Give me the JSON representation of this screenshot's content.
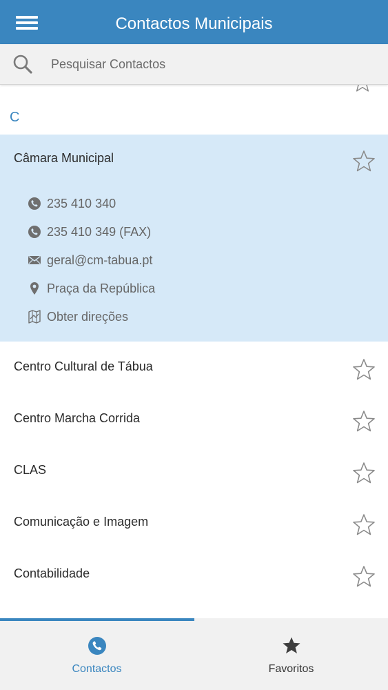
{
  "colors": {
    "primary": "#3a86bf",
    "expanded_bg": "#d6e9f8",
    "text_dark": "#2b2b2b",
    "text_muted": "#666666",
    "nav_bg": "#f1f1f1"
  },
  "header": {
    "title": "Contactos Municipais",
    "menu_icon": "hamburger-menu-icon"
  },
  "search": {
    "placeholder": "Pesquisar Contactos",
    "value": "",
    "icon": "search-icon"
  },
  "list": {
    "section_letter": "C",
    "expanded_item": {
      "title": "Câmara Municipal",
      "favorite": false,
      "details": [
        {
          "icon": "phone-icon",
          "text": "235 410 340"
        },
        {
          "icon": "phone-icon",
          "text": "235 410 349 (FAX)"
        },
        {
          "icon": "envelope-icon",
          "text": "geral@cm-tabua.pt"
        },
        {
          "icon": "map-pin-icon",
          "text": "Praça da República"
        },
        {
          "icon": "directions-map-icon",
          "text": "Obter direções"
        }
      ]
    },
    "items": [
      {
        "title": "Centro Cultural de Tábua",
        "favorite": false
      },
      {
        "title": "Centro Marcha Corrida",
        "favorite": false
      },
      {
        "title": "CLAS",
        "favorite": false
      },
      {
        "title": "Comunicação e Imagem",
        "favorite": false
      },
      {
        "title": "Contabilidade",
        "favorite": false
      }
    ]
  },
  "bottom_nav": {
    "tabs": [
      {
        "label": "Contactos",
        "icon": "phone-circle-icon",
        "active": true
      },
      {
        "label": "Favoritos",
        "icon": "star-filled-icon",
        "active": false
      }
    ]
  }
}
